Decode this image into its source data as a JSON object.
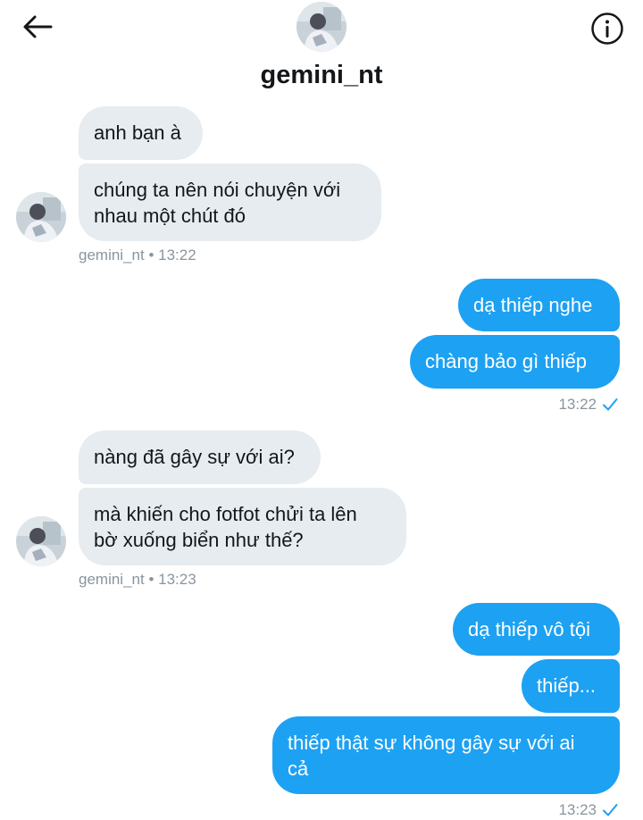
{
  "header": {
    "title": "gemini_nt",
    "back_icon": "arrow-left-icon",
    "info_icon": "info-icon"
  },
  "colors": {
    "incoming_bubble": "#e6ecf0",
    "outgoing_bubble": "#1da1f2",
    "meta_text": "#8a959e",
    "read_check": "#1da1f2"
  },
  "conversation": {
    "group1": {
      "messages": [
        "anh bạn à",
        "chúng ta nên nói chuyện với\nnhau một chút đó"
      ],
      "sender": "gemini_nt",
      "time": "13:22"
    },
    "group2": {
      "messages": [
        "dạ thiếp nghe",
        "chàng bảo gì thiếp"
      ],
      "time": "13:22",
      "status_icon": "checkmark-icon"
    },
    "group3": {
      "messages": [
        "nàng đã gây sự với ai?",
        "mà khiến cho fotfot chửi ta lên\nbờ xuống biển như thế?"
      ],
      "sender": "gemini_nt",
      "time": "13:23"
    },
    "group4": {
      "messages": [
        "dạ thiếp vô tội",
        "thiếp...",
        "thiếp thật sự không gây sự với ai\ncả"
      ],
      "time": "13:23",
      "status_icon": "checkmark-icon"
    }
  },
  "meta_separator": "•"
}
